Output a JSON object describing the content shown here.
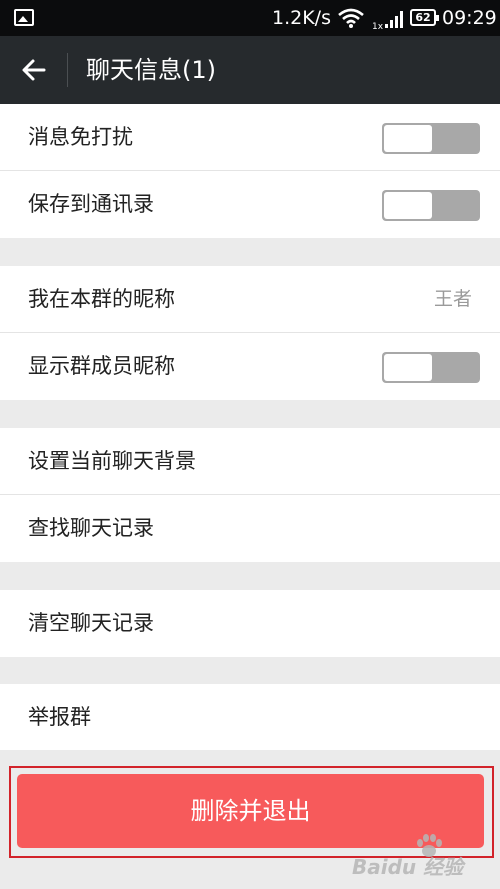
{
  "status_bar": {
    "speed": "1.2K/s",
    "network": "1x",
    "battery": "62",
    "time": "09:29"
  },
  "header": {
    "title": "聊天信息(1)"
  },
  "groups": [
    {
      "rows": [
        {
          "label": "消息免打扰",
          "toggle": "off"
        },
        {
          "label": "保存到通讯录",
          "toggle": "off"
        }
      ]
    },
    {
      "rows": [
        {
          "label": "我在本群的昵称",
          "value": "王者"
        },
        {
          "label": "显示群成员昵称",
          "toggle": "off"
        }
      ]
    },
    {
      "rows": [
        {
          "label": "设置当前聊天背景"
        },
        {
          "label": "查找聊天记录"
        }
      ]
    },
    {
      "rows": [
        {
          "label": "清空聊天记录"
        }
      ]
    },
    {
      "rows": [
        {
          "label": "举报群"
        }
      ]
    }
  ],
  "delete_button": {
    "label": "删除并退出"
  },
  "watermark": {
    "text": "Baidu 经验"
  },
  "colors": {
    "header_bg": "#262a2d",
    "delete_bg": "#f75a5b",
    "highlight_border": "#d2232a"
  }
}
